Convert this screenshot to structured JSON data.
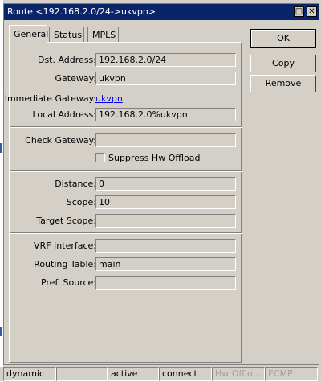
{
  "window": {
    "title": "Route <192.168.2.0/24->ukvpn>",
    "restore_glyph": "□",
    "close_glyph": "✕"
  },
  "tabs": [
    {
      "label": "General",
      "active": true
    },
    {
      "label": "Status",
      "active": false
    },
    {
      "label": "MPLS",
      "active": false
    }
  ],
  "form": {
    "dst_address": {
      "label": "Dst. Address:",
      "value": "192.168.2.0/24"
    },
    "gateway": {
      "label": "Gateway:",
      "value": "ukvpn"
    },
    "immediate_gateway": {
      "label": "Immediate Gateway:",
      "value": "ukvpn"
    },
    "local_address": {
      "label": "Local Address:",
      "value": "192.168.2.0%ukvpn"
    },
    "check_gateway": {
      "label": "Check Gateway:",
      "value": ""
    },
    "suppress_hw_offload": {
      "label": "Suppress Hw Offload",
      "checked": false
    },
    "distance": {
      "label": "Distance:",
      "value": "0"
    },
    "scope": {
      "label": "Scope:",
      "value": "10"
    },
    "target_scope": {
      "label": "Target Scope:",
      "value": ""
    },
    "vrf_interface": {
      "label": "VRF Interface:",
      "value": ""
    },
    "routing_table": {
      "label": "Routing Table:",
      "value": "main"
    },
    "pref_source": {
      "label": "Pref. Source:",
      "value": ""
    }
  },
  "buttons": {
    "ok": "OK",
    "copy": "Copy",
    "remove": "Remove"
  },
  "statusbar": [
    {
      "text": "dynamic",
      "dim": false
    },
    {
      "text": "",
      "dim": false
    },
    {
      "text": "active",
      "dim": false
    },
    {
      "text": "connect",
      "dim": false
    },
    {
      "text": "Hw Offlo...",
      "dim": true
    },
    {
      "text": "ECMP",
      "dim": true
    }
  ]
}
